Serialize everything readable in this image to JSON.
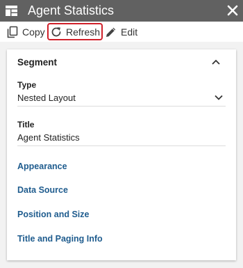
{
  "window": {
    "title": "Agent Statistics"
  },
  "toolbar": {
    "copy_label": "Copy",
    "refresh_label": "Refresh",
    "edit_label": "Edit"
  },
  "panel": {
    "section_title": "Segment",
    "type_label": "Type",
    "type_value": "Nested Layout",
    "title_label": "Title",
    "title_value": "Agent Statistics",
    "links": [
      "Appearance",
      "Data Source",
      "Position and Size",
      "Title and Paging Info"
    ]
  },
  "colors": {
    "titlebar": "#616161",
    "link": "#1f5c8e",
    "highlight": "#d0202a"
  },
  "icons": {
    "app": "layout-grid-icon",
    "close": "close-icon",
    "copy": "copy-icon",
    "refresh": "refresh-icon",
    "edit": "pencil-icon",
    "collapse": "chevron-up-icon",
    "select": "chevron-down-icon"
  }
}
